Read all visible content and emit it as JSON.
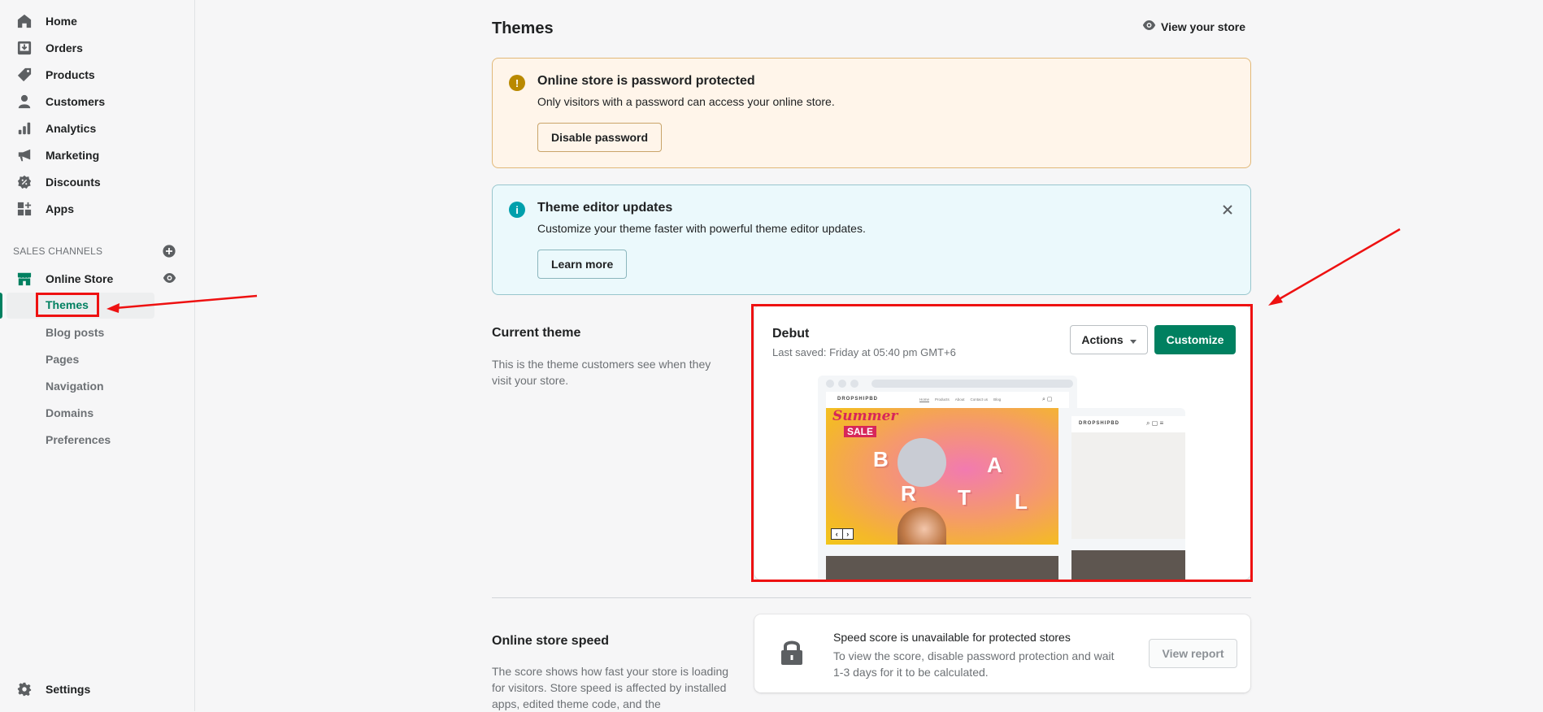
{
  "sidebar": {
    "items": [
      {
        "label": "Home",
        "icon": "home-icon"
      },
      {
        "label": "Orders",
        "icon": "orders-icon"
      },
      {
        "label": "Products",
        "icon": "tag-icon"
      },
      {
        "label": "Customers",
        "icon": "person-icon"
      },
      {
        "label": "Analytics",
        "icon": "bar-chart-icon"
      },
      {
        "label": "Marketing",
        "icon": "megaphone-icon"
      },
      {
        "label": "Discounts",
        "icon": "discount-badge-icon"
      },
      {
        "label": "Apps",
        "icon": "apps-icon"
      }
    ],
    "sales_channels_label": "SALES CHANNELS",
    "online_store": {
      "label": "Online Store",
      "sub_items": [
        {
          "label": "Themes",
          "active": true
        },
        {
          "label": "Blog posts"
        },
        {
          "label": "Pages"
        },
        {
          "label": "Navigation"
        },
        {
          "label": "Domains"
        },
        {
          "label": "Preferences"
        }
      ]
    },
    "settings_label": "Settings"
  },
  "header": {
    "title": "Themes",
    "view_store_label": "View your store"
  },
  "banners": {
    "password": {
      "title": "Online store is password protected",
      "text": "Only visitors with a password can access your online store.",
      "button": "Disable password",
      "icon_glyph": "!",
      "color": "#b98900"
    },
    "editor": {
      "title": "Theme editor updates",
      "text": "Customize your theme faster with powerful theme editor updates.",
      "button": "Learn more",
      "icon_glyph": "i",
      "color": "#00a0ac"
    }
  },
  "current_theme": {
    "section_title": "Current theme",
    "section_desc": "This is the theme customers see when they visit your store.",
    "name": "Debut",
    "last_saved": "Last saved: Friday at 05:40 pm GMT+6",
    "actions_label": "Actions",
    "customize_label": "Customize",
    "preview": {
      "brand": "DROPSHIPBD",
      "nav": [
        "Home",
        "Products",
        "About",
        "Contact us",
        "Blog"
      ],
      "hero_summer": "Summer",
      "hero_sale": "SALE",
      "hero_letters": [
        "B",
        "R",
        "T",
        "A",
        "L"
      ]
    }
  },
  "speed": {
    "section_title": "Online store speed",
    "section_desc": "The score shows how fast your store is loading for visitors. Store speed is affected by installed apps, edited theme code, and the",
    "card_title": "Speed score is unavailable for protected stores",
    "card_text": "To view the score, disable password protection and wait 1-3 days for it to be calculated.",
    "button": "View report"
  },
  "colors": {
    "accent": "#008060",
    "annotation": "#ee1111"
  }
}
